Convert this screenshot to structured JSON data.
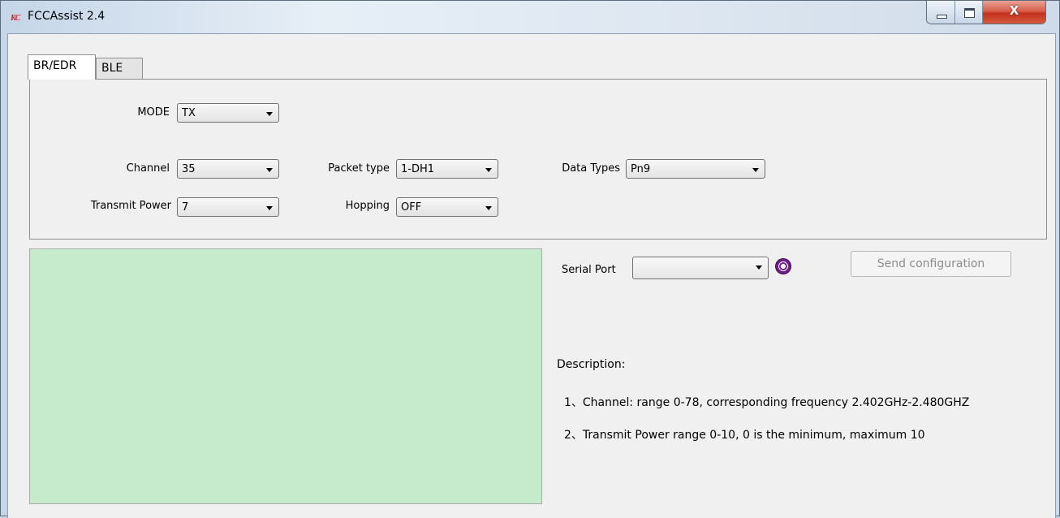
{
  "window": {
    "title": "FCCAssist 2.4",
    "app_icon_text": "KC",
    "close_glyph": "X"
  },
  "tabs": [
    {
      "label": "BR/EDR",
      "active": true
    },
    {
      "label": "BLE",
      "active": false
    }
  ],
  "config": {
    "mode": {
      "label": "MODE",
      "value": "TX"
    },
    "channel": {
      "label": "Channel",
      "value": "35"
    },
    "transmit_power": {
      "label": "Transmit Power",
      "value": "7"
    },
    "packet_type": {
      "label": "Packet type",
      "value": "1-DH1"
    },
    "hopping": {
      "label": "Hopping",
      "value": "OFF"
    },
    "data_types": {
      "label": "Data Types",
      "value": "Pn9"
    }
  },
  "serial": {
    "label": "Serial Port",
    "value": "",
    "refresh_icon": "radio-signal-icon"
  },
  "send_button": {
    "label": "Send configuration",
    "enabled": false
  },
  "description": {
    "title": "Description:",
    "lines": [
      "1、Channel: range 0-78, corresponding frequency 2.402GHz-2.480GHZ",
      "2、Transmit Power  range 0-10, 0 is the minimum, maximum 10"
    ]
  },
  "colors": {
    "output_background": "#c6ebcc",
    "close_button": "#c2311d",
    "icon_purple": "#7d2496"
  }
}
